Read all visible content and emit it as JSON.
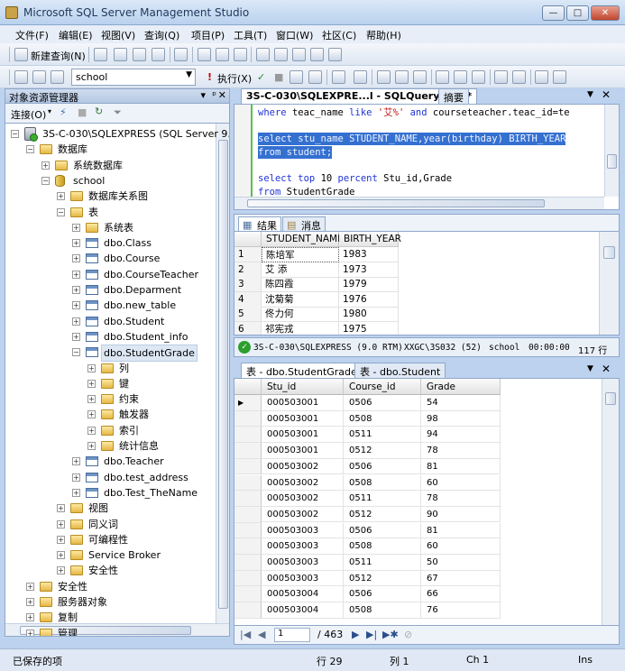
{
  "window": {
    "title": "Microsoft SQL Server Management Studio",
    "buttons": [
      "—",
      "□",
      "✕"
    ]
  },
  "menu": [
    "文件(F)",
    "编辑(E)",
    "视图(V)",
    "查询(Q)",
    "项目(P)",
    "工具(T)",
    "窗口(W)",
    "社区(C)",
    "帮助(H)"
  ],
  "toolbar1": {
    "new_query": "新建查询(N)"
  },
  "toolbar2": {
    "database": "school",
    "execute": "执行(X)"
  },
  "object_explorer": {
    "title": "对象资源管理器",
    "connect": "连接(O)",
    "tree": [
      {
        "label": "3S-C-030\\SQLEXPRESS (SQL Server 9.0",
        "icon": "server",
        "exp": "−",
        "indent": 0
      },
      {
        "label": "数据库",
        "icon": "folder",
        "exp": "−",
        "indent": 1
      },
      {
        "label": "系统数据库",
        "icon": "folder",
        "exp": "+",
        "indent": 2
      },
      {
        "label": "school",
        "icon": "database",
        "exp": "−",
        "indent": 2
      },
      {
        "label": "数据库关系图",
        "icon": "folder",
        "exp": "+",
        "indent": 3
      },
      {
        "label": "表",
        "icon": "folder",
        "exp": "−",
        "indent": 3
      },
      {
        "label": "系统表",
        "icon": "folder",
        "exp": "+",
        "indent": 4
      },
      {
        "label": "dbo.Class",
        "icon": "table",
        "exp": "+",
        "indent": 4
      },
      {
        "label": "dbo.Course",
        "icon": "table",
        "exp": "+",
        "indent": 4
      },
      {
        "label": "dbo.CourseTeacher",
        "icon": "table",
        "exp": "+",
        "indent": 4
      },
      {
        "label": "dbo.Deparment",
        "icon": "table",
        "exp": "+",
        "indent": 4
      },
      {
        "label": "dbo.new_table",
        "icon": "table",
        "exp": "+",
        "indent": 4
      },
      {
        "label": "dbo.Student",
        "icon": "table",
        "exp": "+",
        "indent": 4
      },
      {
        "label": "dbo.Student_info",
        "icon": "table",
        "exp": "+",
        "indent": 4
      },
      {
        "label": "dbo.StudentGrade",
        "icon": "table",
        "exp": "−",
        "indent": 4,
        "selected": true
      },
      {
        "label": "列",
        "icon": "folder",
        "exp": "+",
        "indent": 5
      },
      {
        "label": "键",
        "icon": "folder",
        "exp": "+",
        "indent": 5
      },
      {
        "label": "约束",
        "icon": "folder",
        "exp": "+",
        "indent": 5
      },
      {
        "label": "触发器",
        "icon": "folder",
        "exp": "+",
        "indent": 5
      },
      {
        "label": "索引",
        "icon": "folder",
        "exp": "+",
        "indent": 5
      },
      {
        "label": "统计信息",
        "icon": "folder",
        "exp": "+",
        "indent": 5
      },
      {
        "label": "dbo.Teacher",
        "icon": "table",
        "exp": "+",
        "indent": 4
      },
      {
        "label": "dbo.test_address",
        "icon": "table",
        "exp": "+",
        "indent": 4
      },
      {
        "label": "dbo.Test_TheName",
        "icon": "table",
        "exp": "+",
        "indent": 4
      },
      {
        "label": "视图",
        "icon": "folder",
        "exp": "+",
        "indent": 3
      },
      {
        "label": "同义词",
        "icon": "folder",
        "exp": "+",
        "indent": 3
      },
      {
        "label": "可编程性",
        "icon": "folder",
        "exp": "+",
        "indent": 3
      },
      {
        "label": "Service Broker",
        "icon": "folder",
        "exp": "+",
        "indent": 3
      },
      {
        "label": "安全性",
        "icon": "folder",
        "exp": "+",
        "indent": 3
      },
      {
        "label": "安全性",
        "icon": "folder",
        "exp": "+",
        "indent": 1
      },
      {
        "label": "服务器对象",
        "icon": "folder",
        "exp": "+",
        "indent": 1
      },
      {
        "label": "复制",
        "icon": "folder",
        "exp": "+",
        "indent": 1
      },
      {
        "label": "管理",
        "icon": "folder",
        "exp": "+",
        "indent": 1
      }
    ]
  },
  "query_tab": {
    "active": "3S-C-030\\SQLEXPRE...l - SQLQuery1.sql*",
    "inactive": "摘要"
  },
  "editor": {
    "lines": [
      {
        "t": "where teac_name like '艾%' and courseteacher.teac_id=te",
        "hl": false
      },
      {
        "t": "",
        "hl": false
      },
      {
        "t": "select stu_name STUDENT_NAME,year(birthday) BIRTH_YEAR",
        "hl": true
      },
      {
        "t": "from student;",
        "hl": true
      },
      {
        "t": "",
        "hl": false
      },
      {
        "t": "select top 10 percent Stu_id,Grade",
        "hl": false
      },
      {
        "t": "from StudentGrade",
        "hl": false
      }
    ]
  },
  "results": {
    "tabs": [
      "结果",
      "消息"
    ],
    "columns": [
      "STUDENT_NAME",
      "BIRTH_YEAR"
    ],
    "rows": [
      [
        "1",
        "陈培军",
        "1983"
      ],
      [
        "2",
        "艾 添",
        "1973"
      ],
      [
        "3",
        "陈四霞",
        "1979"
      ],
      [
        "4",
        "沈菊菊",
        "1976"
      ],
      [
        "5",
        "佟力何",
        "1980"
      ],
      [
        "6",
        "祁宪戎",
        "1975"
      ]
    ]
  },
  "query_status": {
    "server": "3S-C-030\\SQLEXPRESS (9.0 RTM)",
    "user": "XXGC\\3S032 (52)",
    "db": "school",
    "time": "00:00:00",
    "rows": "117 行"
  },
  "table_tabs": {
    "active": "表 - dbo.StudentGrade",
    "inactive": "表 - dbo.Student"
  },
  "table_grid": {
    "columns": [
      "Stu_id",
      "Course_id",
      "Grade"
    ],
    "rows": [
      [
        "000503001",
        "0506",
        "54"
      ],
      [
        "000503001",
        "0508",
        "98"
      ],
      [
        "000503001",
        "0511",
        "94"
      ],
      [
        "000503001",
        "0512",
        "78"
      ],
      [
        "000503002",
        "0506",
        "81"
      ],
      [
        "000503002",
        "0508",
        "60"
      ],
      [
        "000503002",
        "0511",
        "78"
      ],
      [
        "000503002",
        "0512",
        "90"
      ],
      [
        "000503003",
        "0506",
        "81"
      ],
      [
        "000503003",
        "0508",
        "60"
      ],
      [
        "000503003",
        "0511",
        "50"
      ],
      [
        "000503003",
        "0512",
        "67"
      ],
      [
        "000503004",
        "0506",
        "66"
      ],
      [
        "000503004",
        "0508",
        "76"
      ]
    ]
  },
  "navigator": {
    "current": "1",
    "total": "/ 463"
  },
  "statusbar": {
    "saved": "已保存的项",
    "row": "行 29",
    "col": "列 1",
    "ch": "Ch 1",
    "ins": "Ins"
  }
}
